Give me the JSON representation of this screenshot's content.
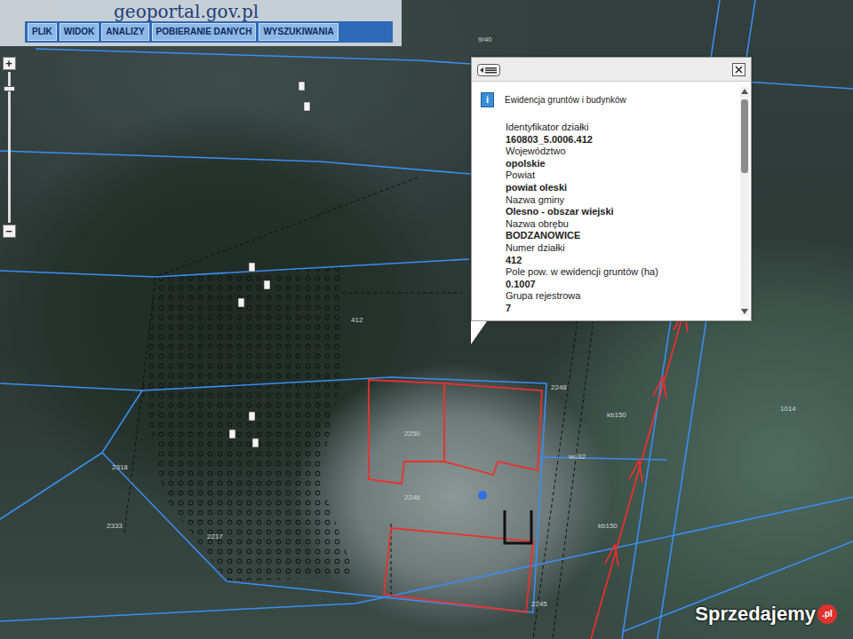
{
  "header": {
    "logo": "geoportal.gov.pl",
    "menu": [
      {
        "label": "PLIK"
      },
      {
        "label": "WIDOK"
      },
      {
        "label": "ANALIZY"
      },
      {
        "label": "POBIERANIE DANYCH"
      },
      {
        "label": "WYSZUKIWANIA"
      }
    ]
  },
  "zoom": {
    "in": "+",
    "out": "−",
    "level": 0.9
  },
  "map": {
    "labels": [
      {
        "text": "412"
      },
      {
        "text": "2248"
      },
      {
        "text": "2250"
      },
      {
        "text": "2246"
      },
      {
        "text": "2245"
      },
      {
        "text": "2318"
      },
      {
        "text": "2333"
      },
      {
        "text": "1014"
      },
      {
        "text": "wo32"
      },
      {
        "text": "kb150"
      },
      {
        "text": "kb150"
      },
      {
        "text": "9/40"
      },
      {
        "text": "2217"
      }
    ]
  },
  "popup": {
    "info": "i",
    "title": "Ewidencja gruntów i budynków",
    "fields": [
      {
        "label": "Identyfikator działki",
        "value": "160803_5.0006.412"
      },
      {
        "label": "Województwo",
        "value": "opolskie"
      },
      {
        "label": "Powiat",
        "value": "powiat oleski"
      },
      {
        "label": "Nazwa gminy",
        "value": "Olesno - obszar wiejski"
      },
      {
        "label": "Nazwa obrębu",
        "value": "BODZANOWICE"
      },
      {
        "label": "Numer działki",
        "value": "412"
      },
      {
        "label": "Pole pow. w ewidencji gruntów (ha)",
        "value": "0.1007"
      },
      {
        "label": "Grupa rejestrowa",
        "value": "7"
      }
    ],
    "scroll": {
      "level": 0.36
    }
  },
  "watermark": {
    "text": "Sprzedajemy",
    "suffix": ".pl"
  }
}
